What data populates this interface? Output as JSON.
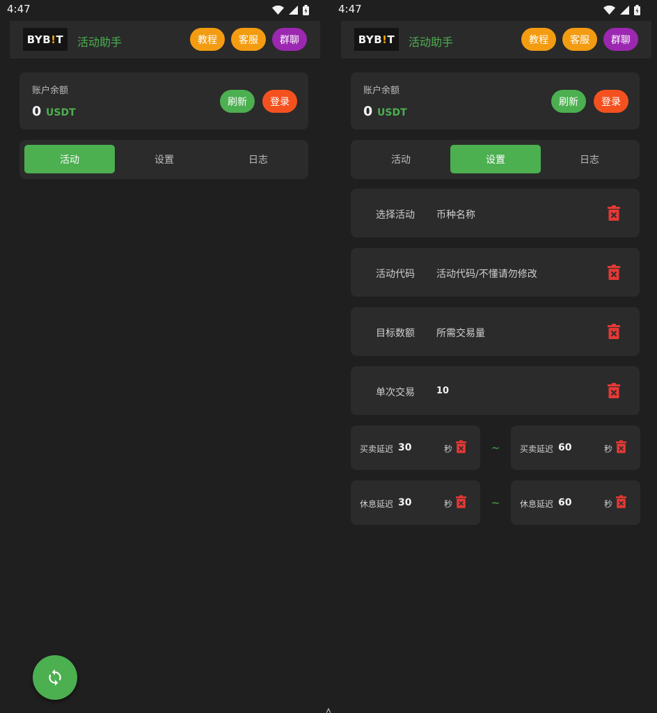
{
  "status_bar": {
    "time": "4:47"
  },
  "header": {
    "logo_main": "BYB",
    "logo_accent": "!",
    "logo_tail": "T",
    "title": "活动助手",
    "buttons": {
      "tutorial": "教程",
      "support": "客服",
      "group_chat": "群聊"
    }
  },
  "balance": {
    "label": "账户余额",
    "value": "0",
    "unit": "USDT",
    "refresh_label": "刷新",
    "login_label": "登录"
  },
  "tabs": [
    "活动",
    "设置",
    "日志"
  ],
  "screens": {
    "left_active_tab": "活动",
    "right_active_tab": "设置"
  },
  "settings": {
    "rows": [
      {
        "label": "选择活动",
        "value": "币种名称"
      },
      {
        "label": "活动代码",
        "value": "活动代码/不懂请勿修改"
      },
      {
        "label": "目标数额",
        "value": "所需交易量"
      },
      {
        "label": "单次交易",
        "value": "10"
      }
    ],
    "trade_delay": {
      "min": {
        "label": "买卖延迟",
        "value": "30",
        "unit": "秒"
      },
      "separator": "~",
      "max": {
        "label": "买卖延迟",
        "value": "60",
        "unit": "秒"
      }
    },
    "rest_delay": {
      "min": {
        "label": "休息延迟",
        "value": "30",
        "unit": "秒"
      },
      "separator": "~",
      "max": {
        "label": "休息延迟",
        "value": "60",
        "unit": "秒"
      }
    }
  },
  "colors": {
    "background": "#1f1f1f",
    "card": "#2b2b2b",
    "accent_green": "#4caf50",
    "orange": "#f39c12",
    "purple": "#9c27b0",
    "red": "#f4511e",
    "trash_red": "#e53935"
  },
  "icons": {
    "wifi": "wifi-icon",
    "signal": "signal-icon",
    "battery": "battery-icon",
    "delete": "trash-icon",
    "refresh": "sync-icon"
  }
}
